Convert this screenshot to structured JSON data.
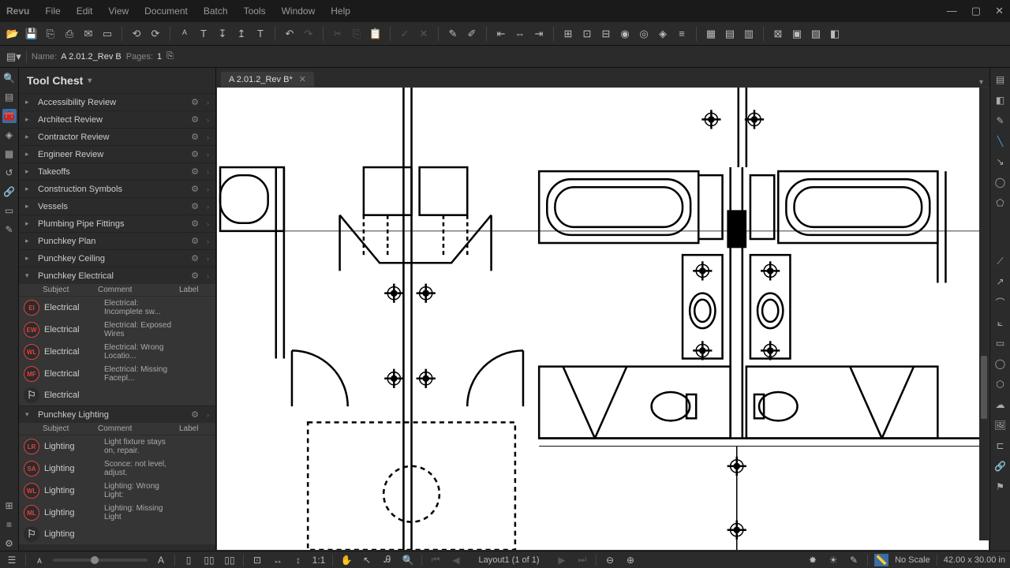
{
  "app": {
    "brand": "Revu"
  },
  "menu": [
    "File",
    "Edit",
    "View",
    "Document",
    "Batch",
    "Tools",
    "Window",
    "Help"
  ],
  "props": {
    "name_label": "Name:",
    "name_value": "A 2.01.2_Rev B",
    "pages_label": "Pages:",
    "pages_value": "1"
  },
  "panel": {
    "title": "Tool Chest",
    "th_subject": "Subject",
    "th_comment": "Comment",
    "th_label": "Label",
    "sets": [
      {
        "name": "Accessibility Review",
        "expanded": false
      },
      {
        "name": "Architect Review",
        "expanded": false
      },
      {
        "name": "Contractor Review",
        "expanded": false
      },
      {
        "name": "Engineer Review",
        "expanded": false
      },
      {
        "name": "Takeoffs",
        "expanded": false
      },
      {
        "name": "Construction Symbols",
        "expanded": false
      },
      {
        "name": "Vessels",
        "expanded": false
      },
      {
        "name": "Plumbing Pipe Fittings",
        "expanded": false
      },
      {
        "name": "Punchkey Plan",
        "expanded": false
      },
      {
        "name": "Punchkey Ceiling",
        "expanded": false
      },
      {
        "name": "Punchkey Electrical",
        "expanded": true,
        "rows": [
          {
            "code": "EI",
            "subject": "Electrical",
            "comment": "Electrical: Incomplete sw..."
          },
          {
            "code": "EW",
            "subject": "Electrical",
            "comment": "Electrical: Exposed Wires"
          },
          {
            "code": "WL",
            "subject": "Electrical",
            "comment": "Electrical: Wrong Locatio..."
          },
          {
            "code": "MF",
            "subject": "Electrical",
            "comment": "Electrical: Missing Facepl..."
          },
          {
            "code": "",
            "subject": "Electrical",
            "comment": ""
          }
        ]
      },
      {
        "name": "Punchkey Lighting",
        "expanded": true,
        "rows": [
          {
            "code": "LR",
            "subject": "Lighting",
            "comment": "Light fixture stays on, repair."
          },
          {
            "code": "SA",
            "subject": "Lighting",
            "comment": "Sconce: not level, adjust."
          },
          {
            "code": "WL",
            "subject": "Lighting",
            "comment": "Lighting:  Wrong Light:"
          },
          {
            "code": "ML",
            "subject": "Lighting",
            "comment": "Lighting: Missing Light"
          },
          {
            "code": "",
            "subject": "Lighting",
            "comment": ""
          }
        ]
      }
    ]
  },
  "tab": {
    "label": "A 2.01.2_Rev B*"
  },
  "status": {
    "layout": "Layout1 (1 of 1)",
    "scale": "No Scale",
    "dims": "42.00 x 30.00 in"
  }
}
